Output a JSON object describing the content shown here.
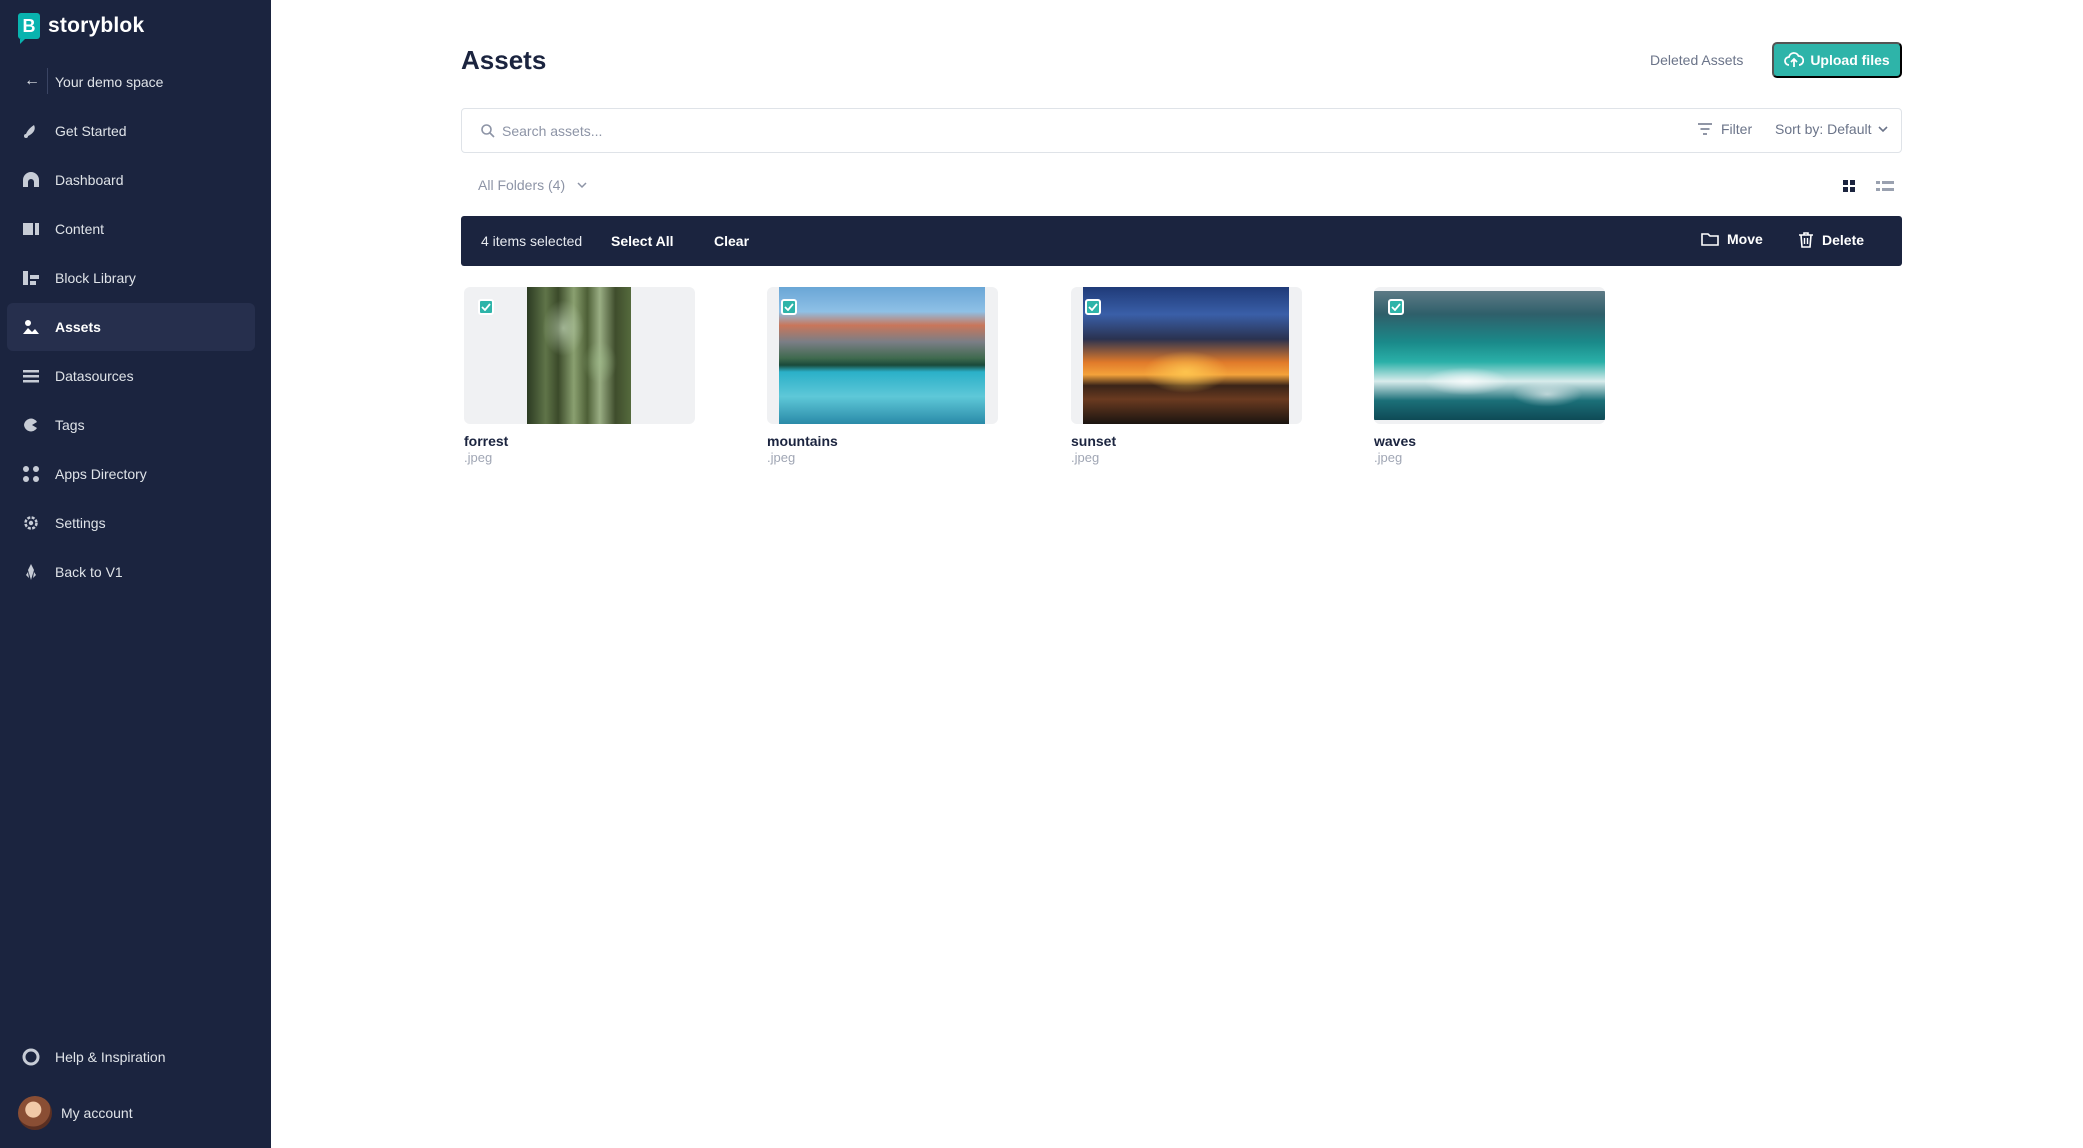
{
  "brand": {
    "logo_letter": "B",
    "name": "storyblok"
  },
  "space": {
    "back_label": "Your demo space"
  },
  "nav": [
    {
      "label": "Get Started",
      "icon": "rocket-icon"
    },
    {
      "label": "Dashboard",
      "icon": "dashboard-icon"
    },
    {
      "label": "Content",
      "icon": "content-icon"
    },
    {
      "label": "Block Library",
      "icon": "block-library-icon"
    },
    {
      "label": "Assets",
      "icon": "assets-icon",
      "active": true
    },
    {
      "label": "Datasources",
      "icon": "datasources-icon"
    },
    {
      "label": "Tags",
      "icon": "tag-icon"
    },
    {
      "label": "Apps Directory",
      "icon": "apps-icon"
    },
    {
      "label": "Settings",
      "icon": "gear-icon"
    },
    {
      "label": "Back to V1",
      "icon": "back-v1-icon"
    }
  ],
  "footer": {
    "help_label": "Help & Inspiration",
    "account_label": "My account"
  },
  "header": {
    "title": "Assets",
    "deleted_link": "Deleted Assets",
    "upload_label": "Upload files"
  },
  "search": {
    "placeholder": "Search assets...",
    "value": "",
    "filter_label": "Filter",
    "sort_label": "Sort by: Default"
  },
  "folders": {
    "selected": "All Folders (4)"
  },
  "selection": {
    "count_label": "4 items selected",
    "select_all_label": "Select All",
    "clear_label": "Clear",
    "move_label": "Move",
    "delete_label": "Delete"
  },
  "assets": [
    {
      "name": "forrest",
      "ext": ".jpeg",
      "checked": true
    },
    {
      "name": "mountains",
      "ext": ".jpeg",
      "checked": true
    },
    {
      "name": "sunset",
      "ext": ".jpeg",
      "checked": true
    },
    {
      "name": "waves",
      "ext": ".jpeg",
      "checked": true
    }
  ],
  "colors": {
    "sidebar_bg": "#1b243f",
    "accent": "#2eb4a9",
    "selection_bar": "#1b243f"
  }
}
